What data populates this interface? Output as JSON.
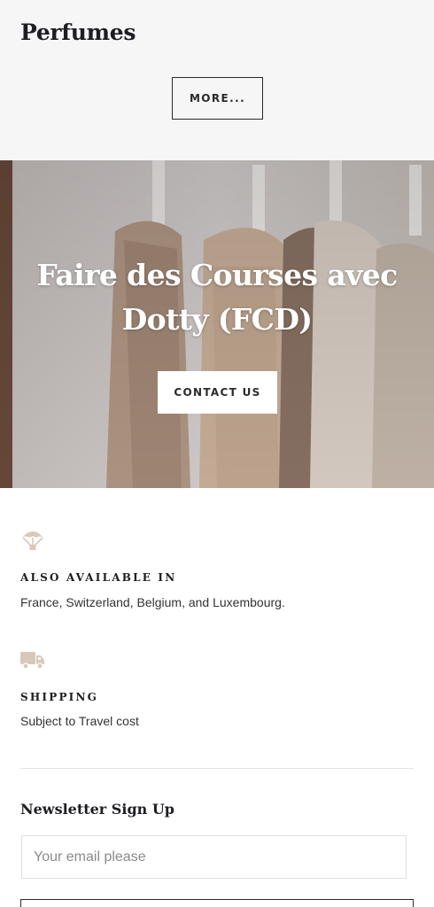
{
  "category": {
    "title": "Perfumes",
    "more_label": "MORE..."
  },
  "hero": {
    "title_line1": "Faire des Courses avec",
    "title_line2": "Dotty (FCD)",
    "contact_label": "CONTACT US"
  },
  "features": [
    {
      "icon": "parachute-icon",
      "title": "ALSO AVAILABLE IN",
      "description": "France, Switzerland, Belgium, and Luxembourg."
    },
    {
      "icon": "delivery-truck-icon",
      "title": "SHIPPING",
      "description": "Subject to Travel cost"
    }
  ],
  "newsletter": {
    "title": "Newsletter Sign Up",
    "email_placeholder": "Your email please",
    "email_value": ""
  },
  "colors": {
    "top_background": "#f6f6f6",
    "icon_accent": "#d9c8b8",
    "text_dark": "#1f1d22"
  }
}
